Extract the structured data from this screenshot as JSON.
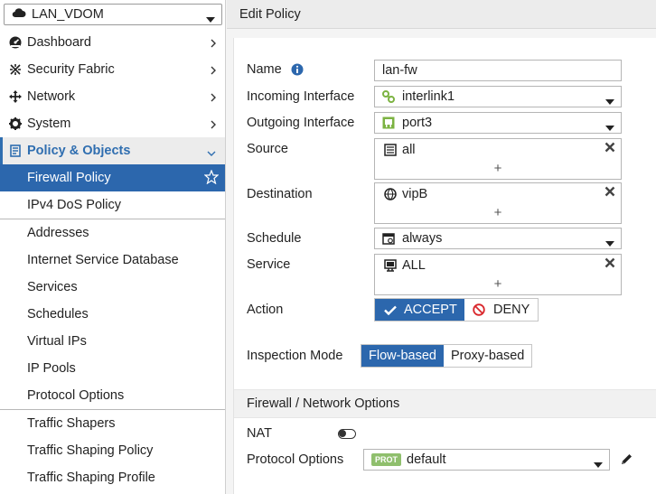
{
  "vdom": {
    "name": "LAN_VDOM",
    "icon": "cloud-icon"
  },
  "sidebar": {
    "items": [
      {
        "label": "Dashboard",
        "icon": "dashboard-icon"
      },
      {
        "label": "Security Fabric",
        "icon": "security-fabric-icon"
      },
      {
        "label": "Network",
        "icon": "network-icon"
      },
      {
        "label": "System",
        "icon": "gear-icon"
      },
      {
        "label": "Policy & Objects",
        "icon": "policy-icon"
      }
    ],
    "sub_items": [
      {
        "label": "Firewall Policy"
      },
      {
        "label": "IPv4 DoS Policy"
      },
      {
        "label": "Addresses"
      },
      {
        "label": "Internet Service Database"
      },
      {
        "label": "Services"
      },
      {
        "label": "Schedules"
      },
      {
        "label": "Virtual IPs"
      },
      {
        "label": "IP Pools"
      },
      {
        "label": "Protocol Options"
      },
      {
        "label": "Traffic Shapers"
      },
      {
        "label": "Traffic Shaping Policy"
      },
      {
        "label": "Traffic Shaping Profile"
      }
    ]
  },
  "header": {
    "title": "Edit Policy"
  },
  "form": {
    "name_label": "Name",
    "name_value": "lan-fw",
    "incoming_label": "Incoming Interface",
    "incoming_value": "interlink1",
    "outgoing_label": "Outgoing Interface",
    "outgoing_value": "port3",
    "source_label": "Source",
    "source_value": "all",
    "destination_label": "Destination",
    "destination_value": "vipB",
    "schedule_label": "Schedule",
    "schedule_value": "always",
    "service_label": "Service",
    "service_value": "ALL",
    "add_symbol": "+",
    "action_label": "Action",
    "action_accept": "ACCEPT",
    "action_deny": "DENY",
    "inspection_label": "Inspection Mode",
    "inspection_flow": "Flow-based",
    "inspection_proxy": "Proxy-based"
  },
  "firewall_options": {
    "section_title": "Firewall / Network Options",
    "nat_label": "NAT",
    "nat_enabled": false,
    "protocol_options_label": "Protocol Options",
    "protocol_badge": "PROT",
    "protocol_value": "default"
  },
  "colors": {
    "accent": "#2c67ad",
    "deny": "#d9262b",
    "interface_green": "#7cb342"
  }
}
